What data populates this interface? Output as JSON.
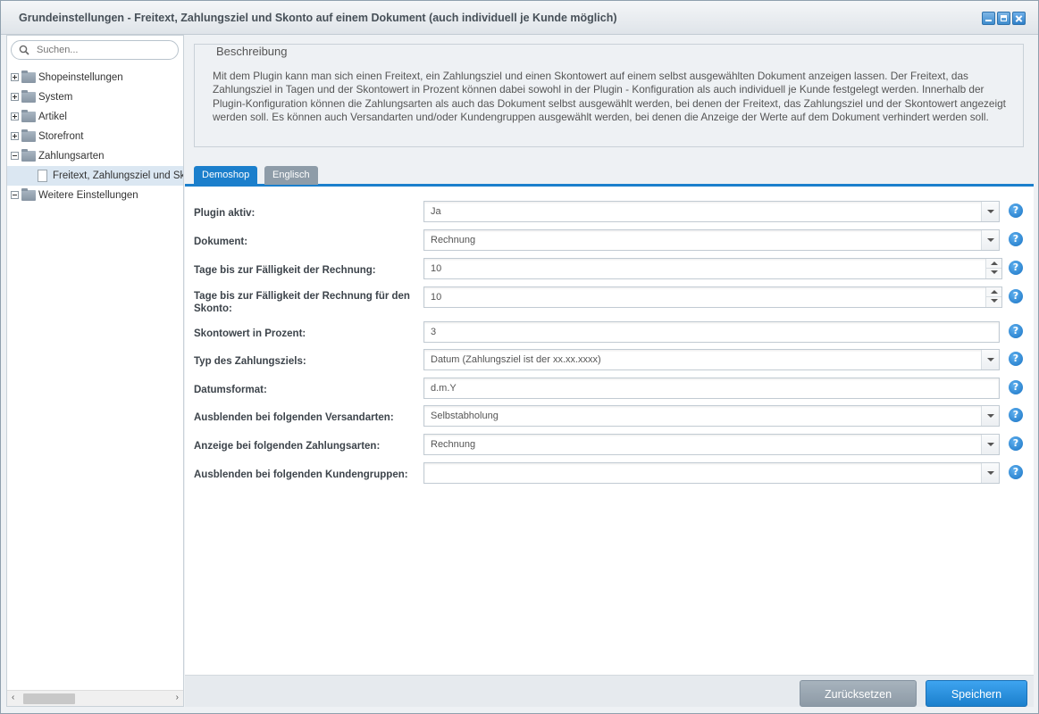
{
  "window": {
    "title": "Grundeinstellungen - Freitext, Zahlungsziel und Skonto auf einem Dokument (auch individuell je Kunde möglich)"
  },
  "sidebar": {
    "search_placeholder": "Suchen...",
    "items": [
      {
        "label": "Shopeinstellungen",
        "expanded": false
      },
      {
        "label": "System",
        "expanded": false
      },
      {
        "label": "Artikel",
        "expanded": false
      },
      {
        "label": "Storefront",
        "expanded": false
      },
      {
        "label": "Zahlungsarten",
        "expanded": true
      },
      {
        "label": "Freitext, Zahlungsziel und Skonto auf einem Dokument (auch individuell je Kunde möglich)",
        "selected": true
      },
      {
        "label": "Weitere Einstellungen",
        "expanded": true
      }
    ]
  },
  "description": {
    "legend": "Beschreibung",
    "text": "Mit dem Plugin kann man sich einen Freitext, ein Zahlungsziel und einen Skontowert auf einem selbst ausgewählten Dokument anzeigen lassen. Der Freitext, das Zahlungsziel in Tagen und der Skontowert in Prozent können dabei sowohl in der Plugin - Konfiguration als auch individuell je Kunde festgelegt werden. Innerhalb der Plugin-Konfiguration können die Zahlungsarten als auch das Dokument selbst ausgewählt werden, bei denen der Freitext, das Zahlungsziel und der Skontowert angezeigt werden soll. Es können auch Versandarten und/oder Kundengruppen ausgewählt werden, bei denen die Anzeige der Werte auf dem Dokument verhindert werden soll."
  },
  "tabs": [
    {
      "label": "Demoshop",
      "active": true
    },
    {
      "label": "Englisch",
      "active": false
    }
  ],
  "form": {
    "fields": [
      {
        "label": "Plugin aktiv:",
        "value": "Ja",
        "control": "select"
      },
      {
        "label": "Dokument:",
        "value": "Rechnung",
        "control": "select"
      },
      {
        "label": "Tage bis zur Fälligkeit der Rechnung:",
        "value": "10",
        "control": "number"
      },
      {
        "label": "Tage bis zur Fälligkeit der Rechnung für den Skonto:",
        "value": "10",
        "control": "number"
      },
      {
        "label": "Skontowert in Prozent:",
        "value": "3",
        "control": "text"
      },
      {
        "label": "Typ des Zahlungsziels:",
        "value": "Datum (Zahlungsziel ist der xx.xx.xxxx)",
        "control": "select"
      },
      {
        "label": "Datumsformat:",
        "value": "d.m.Y",
        "control": "text"
      },
      {
        "label": "Ausblenden bei folgenden Versandarten:",
        "value": "Selbstabholung",
        "control": "select"
      },
      {
        "label": "Anzeige bei folgenden Zahlungsarten:",
        "value": "Rechnung",
        "control": "select"
      },
      {
        "label": "Ausblenden bei folgenden Kundengruppen:",
        "value": "",
        "control": "select"
      }
    ],
    "help_glyph": "?"
  },
  "footer": {
    "reset_label": "Zurücksetzen",
    "save_label": "Speichern"
  },
  "colors": {
    "accent": "#1b7fcc",
    "inactive_tab": "#8e9ca8"
  }
}
